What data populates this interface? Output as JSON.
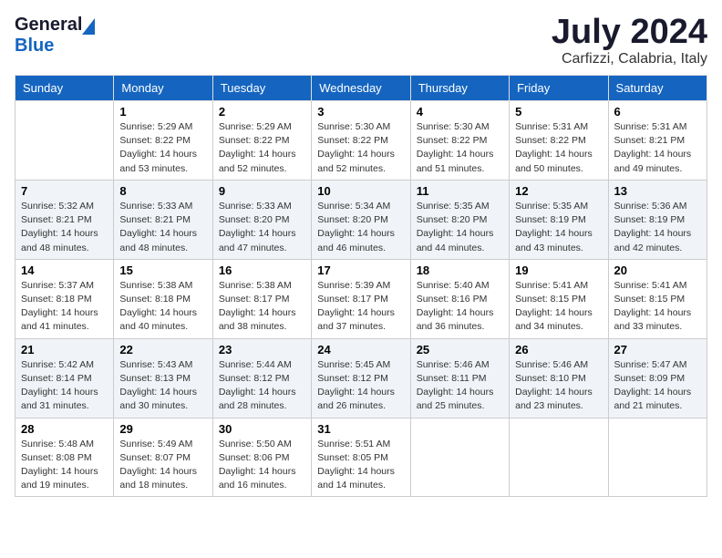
{
  "header": {
    "logo_general": "General",
    "logo_blue": "Blue",
    "month": "July 2024",
    "location": "Carfizzi, Calabria, Italy"
  },
  "weekdays": [
    "Sunday",
    "Monday",
    "Tuesday",
    "Wednesday",
    "Thursday",
    "Friday",
    "Saturday"
  ],
  "weeks": [
    [
      {
        "day": "",
        "info": ""
      },
      {
        "day": "1",
        "info": "Sunrise: 5:29 AM\nSunset: 8:22 PM\nDaylight: 14 hours\nand 53 minutes."
      },
      {
        "day": "2",
        "info": "Sunrise: 5:29 AM\nSunset: 8:22 PM\nDaylight: 14 hours\nand 52 minutes."
      },
      {
        "day": "3",
        "info": "Sunrise: 5:30 AM\nSunset: 8:22 PM\nDaylight: 14 hours\nand 52 minutes."
      },
      {
        "day": "4",
        "info": "Sunrise: 5:30 AM\nSunset: 8:22 PM\nDaylight: 14 hours\nand 51 minutes."
      },
      {
        "day": "5",
        "info": "Sunrise: 5:31 AM\nSunset: 8:22 PM\nDaylight: 14 hours\nand 50 minutes."
      },
      {
        "day": "6",
        "info": "Sunrise: 5:31 AM\nSunset: 8:21 PM\nDaylight: 14 hours\nand 49 minutes."
      }
    ],
    [
      {
        "day": "7",
        "info": "Sunrise: 5:32 AM\nSunset: 8:21 PM\nDaylight: 14 hours\nand 48 minutes."
      },
      {
        "day": "8",
        "info": "Sunrise: 5:33 AM\nSunset: 8:21 PM\nDaylight: 14 hours\nand 48 minutes."
      },
      {
        "day": "9",
        "info": "Sunrise: 5:33 AM\nSunset: 8:20 PM\nDaylight: 14 hours\nand 47 minutes."
      },
      {
        "day": "10",
        "info": "Sunrise: 5:34 AM\nSunset: 8:20 PM\nDaylight: 14 hours\nand 46 minutes."
      },
      {
        "day": "11",
        "info": "Sunrise: 5:35 AM\nSunset: 8:20 PM\nDaylight: 14 hours\nand 44 minutes."
      },
      {
        "day": "12",
        "info": "Sunrise: 5:35 AM\nSunset: 8:19 PM\nDaylight: 14 hours\nand 43 minutes."
      },
      {
        "day": "13",
        "info": "Sunrise: 5:36 AM\nSunset: 8:19 PM\nDaylight: 14 hours\nand 42 minutes."
      }
    ],
    [
      {
        "day": "14",
        "info": "Sunrise: 5:37 AM\nSunset: 8:18 PM\nDaylight: 14 hours\nand 41 minutes."
      },
      {
        "day": "15",
        "info": "Sunrise: 5:38 AM\nSunset: 8:18 PM\nDaylight: 14 hours\nand 40 minutes."
      },
      {
        "day": "16",
        "info": "Sunrise: 5:38 AM\nSunset: 8:17 PM\nDaylight: 14 hours\nand 38 minutes."
      },
      {
        "day": "17",
        "info": "Sunrise: 5:39 AM\nSunset: 8:17 PM\nDaylight: 14 hours\nand 37 minutes."
      },
      {
        "day": "18",
        "info": "Sunrise: 5:40 AM\nSunset: 8:16 PM\nDaylight: 14 hours\nand 36 minutes."
      },
      {
        "day": "19",
        "info": "Sunrise: 5:41 AM\nSunset: 8:15 PM\nDaylight: 14 hours\nand 34 minutes."
      },
      {
        "day": "20",
        "info": "Sunrise: 5:41 AM\nSunset: 8:15 PM\nDaylight: 14 hours\nand 33 minutes."
      }
    ],
    [
      {
        "day": "21",
        "info": "Sunrise: 5:42 AM\nSunset: 8:14 PM\nDaylight: 14 hours\nand 31 minutes."
      },
      {
        "day": "22",
        "info": "Sunrise: 5:43 AM\nSunset: 8:13 PM\nDaylight: 14 hours\nand 30 minutes."
      },
      {
        "day": "23",
        "info": "Sunrise: 5:44 AM\nSunset: 8:12 PM\nDaylight: 14 hours\nand 28 minutes."
      },
      {
        "day": "24",
        "info": "Sunrise: 5:45 AM\nSunset: 8:12 PM\nDaylight: 14 hours\nand 26 minutes."
      },
      {
        "day": "25",
        "info": "Sunrise: 5:46 AM\nSunset: 8:11 PM\nDaylight: 14 hours\nand 25 minutes."
      },
      {
        "day": "26",
        "info": "Sunrise: 5:46 AM\nSunset: 8:10 PM\nDaylight: 14 hours\nand 23 minutes."
      },
      {
        "day": "27",
        "info": "Sunrise: 5:47 AM\nSunset: 8:09 PM\nDaylight: 14 hours\nand 21 minutes."
      }
    ],
    [
      {
        "day": "28",
        "info": "Sunrise: 5:48 AM\nSunset: 8:08 PM\nDaylight: 14 hours\nand 19 minutes."
      },
      {
        "day": "29",
        "info": "Sunrise: 5:49 AM\nSunset: 8:07 PM\nDaylight: 14 hours\nand 18 minutes."
      },
      {
        "day": "30",
        "info": "Sunrise: 5:50 AM\nSunset: 8:06 PM\nDaylight: 14 hours\nand 16 minutes."
      },
      {
        "day": "31",
        "info": "Sunrise: 5:51 AM\nSunset: 8:05 PM\nDaylight: 14 hours\nand 14 minutes."
      },
      {
        "day": "",
        "info": ""
      },
      {
        "day": "",
        "info": ""
      },
      {
        "day": "",
        "info": ""
      }
    ]
  ]
}
